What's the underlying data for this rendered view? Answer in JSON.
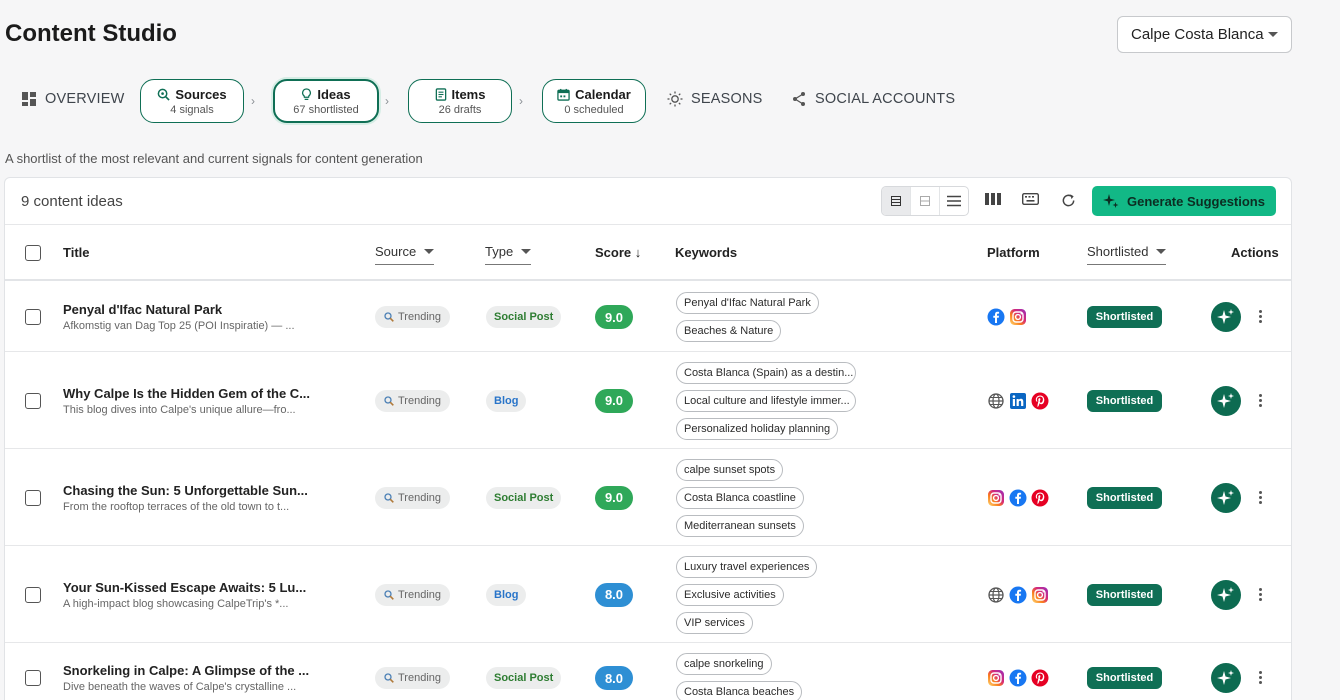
{
  "header": {
    "title": "Content Studio",
    "workspace": "Calpe Costa Blanca"
  },
  "nav": {
    "overview": "OVERVIEW",
    "steps": [
      {
        "label": "Sources",
        "sub": "4 signals",
        "icon": "search-signal-icon"
      },
      {
        "label": "Ideas",
        "sub": "67 shortlisted",
        "icon": "lightbulb-icon"
      },
      {
        "label": "Items",
        "sub": "26 drafts",
        "icon": "document-icon"
      },
      {
        "label": "Calendar",
        "sub": "0 scheduled",
        "icon": "calendar-icon"
      }
    ],
    "seasons": "SEASONS",
    "social": "SOCIAL ACCOUNTS"
  },
  "subtitle": "A shortlist of the most relevant and current signals for content generation",
  "toolbar": {
    "count": "9 content ideas",
    "generate": "Generate Suggestions"
  },
  "columns": {
    "title": "Title",
    "source": "Source",
    "type": "Type",
    "score": "Score ↓",
    "keywords": "Keywords",
    "platform": "Platform",
    "shortlisted": "Shortlisted",
    "actions": "Actions"
  },
  "colors": {
    "accent": "#0f6f55",
    "button": "#12b886",
    "score_green": "#2fa859",
    "score_blue": "#2e8fd4"
  },
  "rows": [
    {
      "title": "Penyal d'Ifac Natural Park",
      "desc": "Afkomstig van Dag Top 25 (POI Inspiratie) — ...",
      "source": "Trending",
      "type": "Social Post",
      "score": "9.0",
      "keywords": [
        "Penyal d'Ifac Natural Park",
        "Beaches & Nature"
      ],
      "platforms": [
        "facebook",
        "instagram"
      ],
      "status": "Shortlisted"
    },
    {
      "title": "Why Calpe Is the Hidden Gem of the C...",
      "desc": "This blog dives into Calpe's unique allure—fro...",
      "source": "Trending",
      "type": "Blog",
      "score": "9.0",
      "keywords": [
        "Costa Blanca (Spain) as a destin...",
        "Local culture and lifestyle immer...",
        "Personalized holiday planning"
      ],
      "platforms": [
        "web",
        "linkedin",
        "pinterest"
      ],
      "status": "Shortlisted"
    },
    {
      "title": "Chasing the Sun: 5 Unforgettable Sun...",
      "desc": "From the rooftop terraces of the old town to t...",
      "source": "Trending",
      "type": "Social Post",
      "score": "9.0",
      "keywords": [
        "calpe sunset spots",
        "Costa Blanca coastline",
        "Mediterranean sunsets"
      ],
      "platforms": [
        "instagram",
        "facebook",
        "pinterest"
      ],
      "status": "Shortlisted"
    },
    {
      "title": "Your Sun-Kissed Escape Awaits: 5 Lu...",
      "desc": "A high-impact blog showcasing CalpeTrip's *...",
      "source": "Trending",
      "type": "Blog",
      "score": "8.0",
      "keywords": [
        "Luxury travel experiences",
        "Exclusive activities",
        "VIP services"
      ],
      "platforms": [
        "web",
        "facebook",
        "instagram"
      ],
      "status": "Shortlisted"
    },
    {
      "title": "Snorkeling in Calpe: A Glimpse of the ...",
      "desc": "Dive beneath the waves of Calpe's crystalline ...",
      "source": "Trending",
      "type": "Social Post",
      "score": "8.0",
      "keywords": [
        "calpe snorkeling",
        "Costa Blanca beaches"
      ],
      "platforms": [
        "instagram",
        "facebook",
        "pinterest"
      ],
      "status": "Shortlisted"
    }
  ]
}
